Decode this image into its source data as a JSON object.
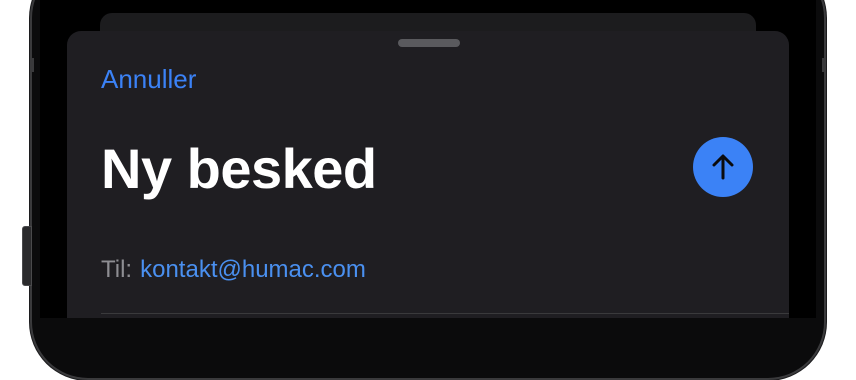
{
  "header": {
    "cancel_label": "Annuller",
    "title": "Ny besked"
  },
  "send_button": {
    "icon": "arrow-up-icon",
    "color": "#3b82f6"
  },
  "to_field": {
    "label": "Til:",
    "value": "kontakt@humac.com"
  },
  "colors": {
    "accent": "#3b82f6",
    "sheet_background": "#1f1e22",
    "title_text": "#ffffff",
    "secondary_text": "#8e8e93"
  }
}
